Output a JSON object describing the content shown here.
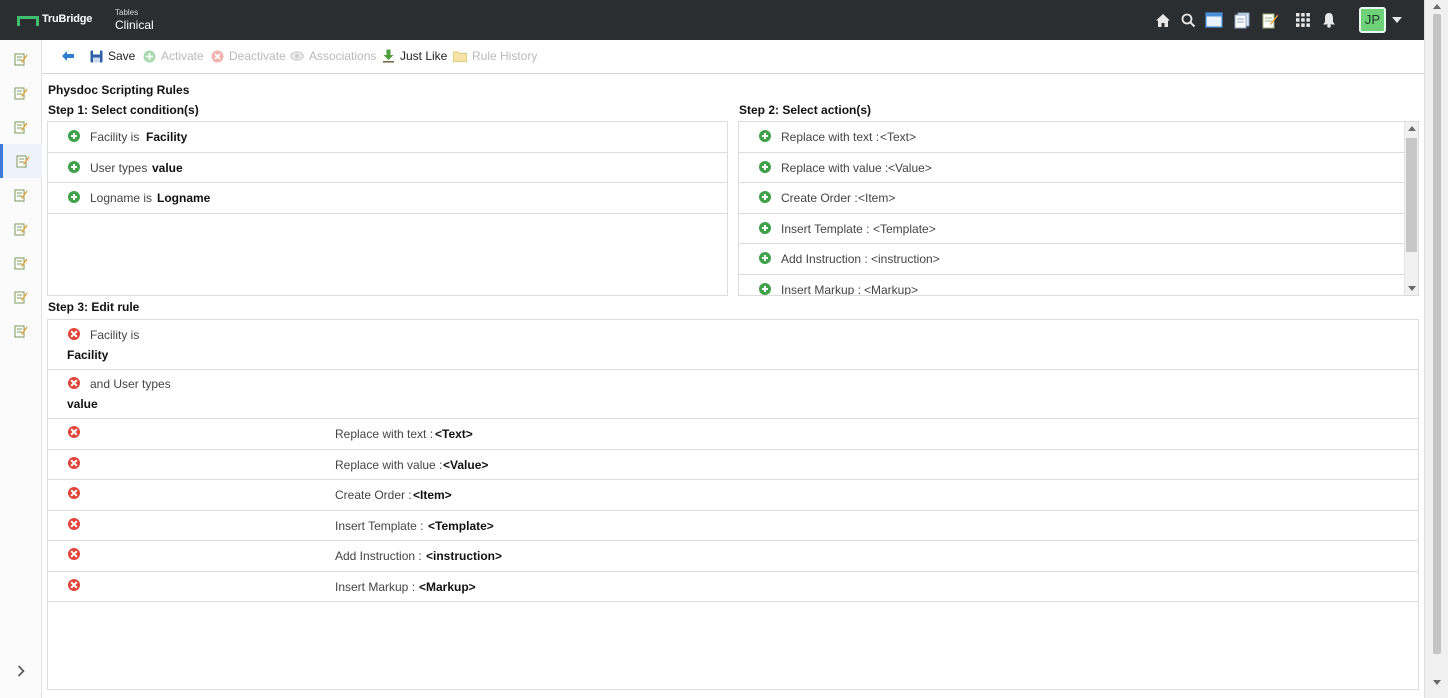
{
  "header": {
    "brand": "TruBridge",
    "context_small": "Tables",
    "context_big": "Clinical",
    "icons": [
      "home-icon",
      "search-icon",
      "window-icon",
      "documents-icon",
      "notes-icon",
      "apps-grid-icon",
      "bell-icon"
    ],
    "user_initials": "JP"
  },
  "toolbar": {
    "save": "Save",
    "activate": "Activate",
    "deactivate": "Deactivate",
    "associations": "Associations",
    "just_like": "Just Like",
    "rule_history": "Rule History"
  },
  "page_title": "Physdoc Scripting Rules",
  "step1": {
    "heading": "Step 1: Select condition(s)",
    "items": [
      {
        "label": "Facility is",
        "value": "Facility"
      },
      {
        "label": "User types",
        "value": "value"
      },
      {
        "label": "Logname is",
        "value": "Logname"
      }
    ]
  },
  "step2": {
    "heading": "Step 2: Select action(s)",
    "items": [
      {
        "label": "Replace with text :",
        "value": "<Text>"
      },
      {
        "label": "Replace with value :",
        "value": "<Value>"
      },
      {
        "label": "Create Order :",
        "value": "<Item>"
      },
      {
        "label": "Insert Template :",
        "value": "<Template>"
      },
      {
        "label": "Add Instruction :",
        "value": "<instruction>"
      },
      {
        "label": "Insert Markup :",
        "value": "<Markup>"
      }
    ]
  },
  "step3": {
    "heading": "Step 3: Edit rule",
    "conditions": [
      {
        "label": "Facility is",
        "value": "Facility"
      },
      {
        "label": "and User types",
        "value": "value"
      }
    ],
    "actions": [
      {
        "label": "Replace with text :",
        "value": "<Text>"
      },
      {
        "label": "Replace with value :",
        "value": "<Value>"
      },
      {
        "label": "Create Order :",
        "value": "<Item>"
      },
      {
        "label": "Insert Template :",
        "value": "<Template>"
      },
      {
        "label": "Add Instruction :",
        "value": "<instruction>"
      },
      {
        "label": "Insert Markup :",
        "value": "<Markup>"
      }
    ]
  },
  "colors": {
    "topbar": "#2b2e31",
    "brand_green": "#3fbf6e",
    "add_green": "#3fa14a",
    "delete_red": "#e0443a",
    "active_blue": "#3b7ad9"
  }
}
